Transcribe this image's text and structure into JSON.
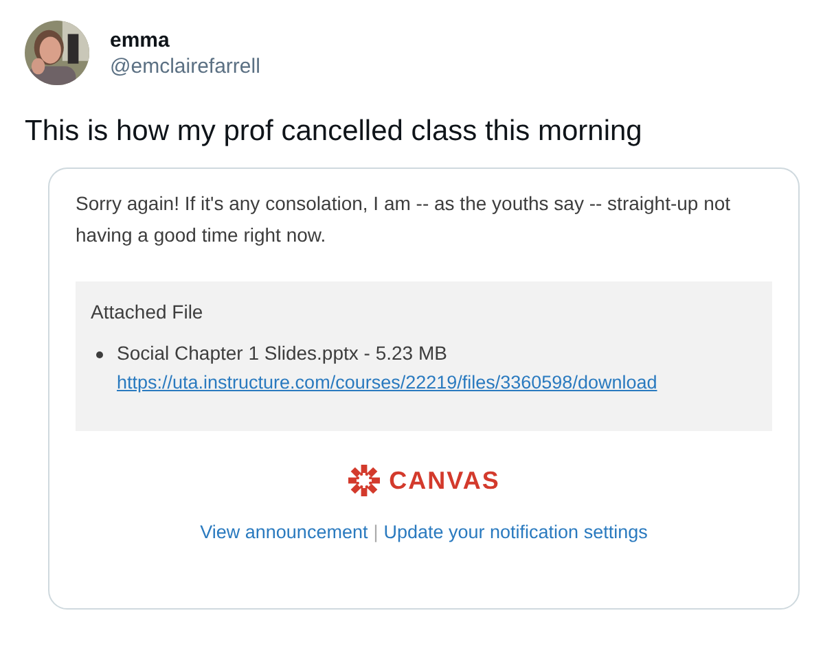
{
  "author": {
    "name": "emma",
    "handle": "@emclairefarrell"
  },
  "tweet_text": "This is how my prof cancelled class this morning",
  "email": {
    "message": "Sorry again! If it's any consolation, I am -- as the youths say -- straight-up not having a good time right now.",
    "attachment": {
      "heading": "Attached File",
      "file": "Social Chapter 1 Slides.pptx - 5.23 MB",
      "url": "https://uta.instructure.com/courses/22219/files/3360598/download"
    },
    "logo_text": "CANVAS",
    "footer_links": [
      "View announcement",
      "Update your notification settings"
    ],
    "separator": "|"
  }
}
